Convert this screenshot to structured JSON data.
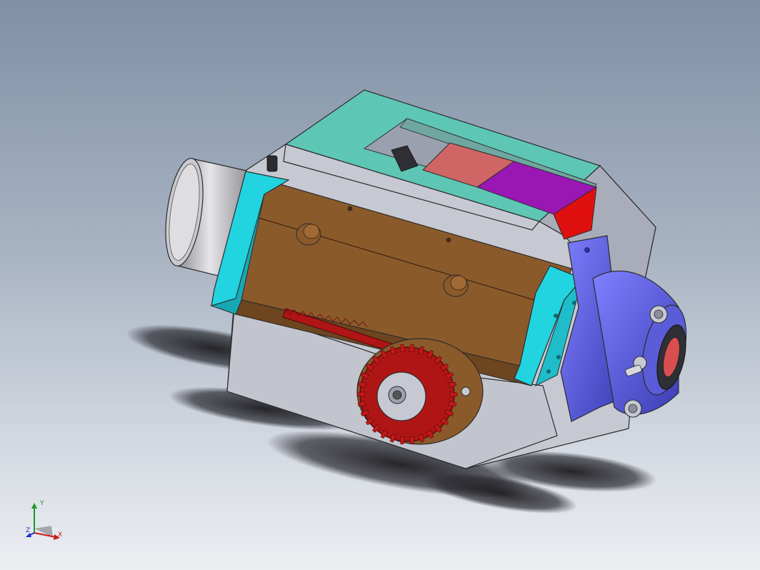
{
  "viewport": {
    "background_top": "#7f90a6",
    "background_bottom": "#eceef2"
  },
  "model": {
    "colors": {
      "housing": "#c6c9d1",
      "housing_shade": "#9ea2ae",
      "cover_top": "#5ec6b4",
      "block_brown": "#8b5a2b",
      "end_caps_cyan": "#22d3e0",
      "gear_red": "#b01515",
      "flange_blue": "#6b6df0",
      "pad_red": "#cf6565",
      "pad_purple": "#9a17b4",
      "cylinder_grey": "#b5b5bb"
    }
  },
  "triad": {
    "x_label": "X",
    "y_label": "Y",
    "z_label": "Z",
    "x_color": "#cc1b1b",
    "y_color": "#1a9a2a",
    "z_color": "#1e2fd0"
  }
}
